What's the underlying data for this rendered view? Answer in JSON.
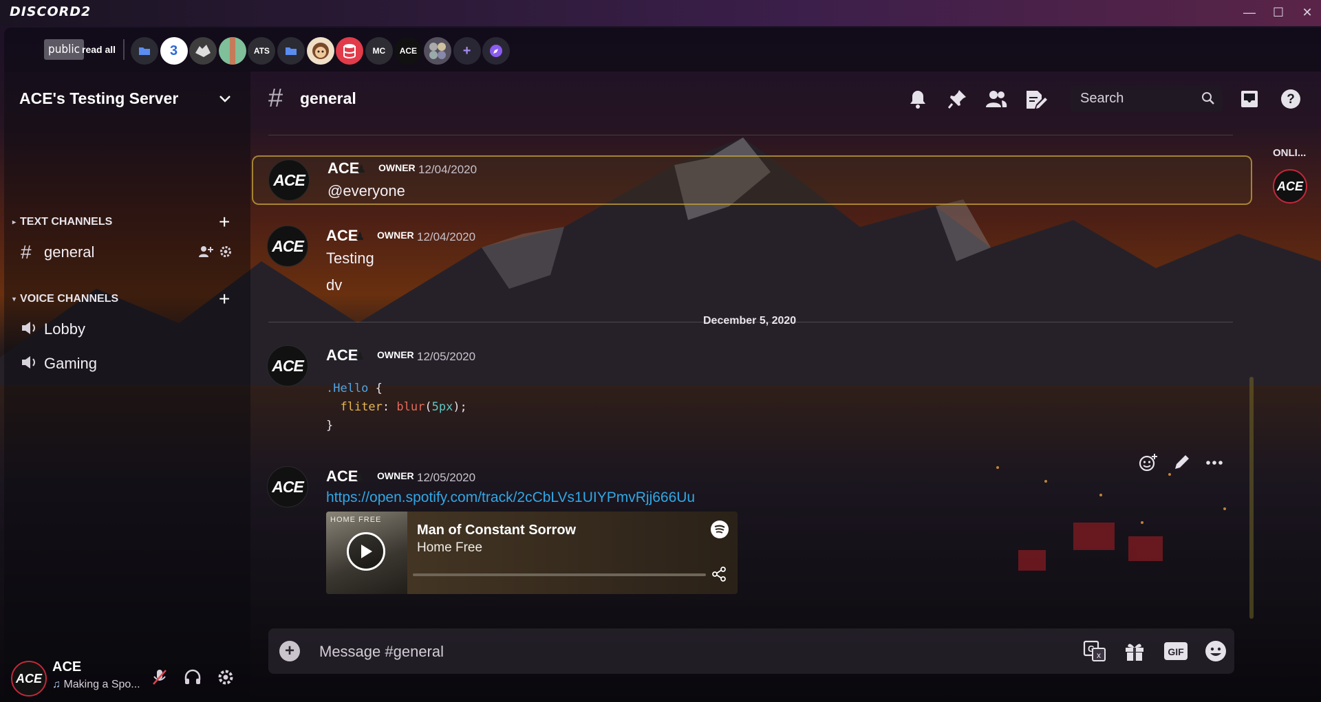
{
  "app": {
    "logo_text": "DISCORD2"
  },
  "window_controls": {
    "minimize": "—",
    "maximize": "☐",
    "close": "✕"
  },
  "server_bar": {
    "public_label": "public",
    "read_all_label": "read all",
    "servers": [
      {
        "name": "folder-1",
        "label": "",
        "color": "#2b2b34",
        "glyph": "folder"
      },
      {
        "name": "server-3",
        "label": "3",
        "color": "#ffffff",
        "glyph": "text"
      },
      {
        "name": "server-wolf",
        "label": "",
        "color": "#3d3d3d",
        "glyph": "wolf"
      },
      {
        "name": "server-green",
        "label": "",
        "color": "#7fbf9a",
        "glyph": "stripe"
      },
      {
        "name": "server-ats",
        "label": "ATS",
        "color": "#2d2d33",
        "glyph": "text"
      },
      {
        "name": "folder-2",
        "label": "",
        "color": "#2b2b34",
        "glyph": "folder"
      },
      {
        "name": "server-face",
        "label": "",
        "color": "#f0e0c8",
        "glyph": "face"
      },
      {
        "name": "server-db",
        "label": "",
        "color": "#e23b4a",
        "glyph": "db"
      },
      {
        "name": "server-mc",
        "label": "MC",
        "color": "#2d2d33",
        "glyph": "text"
      },
      {
        "name": "server-ace",
        "label": "ACE",
        "color": "#111111",
        "glyph": "text"
      },
      {
        "name": "server-multi",
        "label": "",
        "color": "#55505e",
        "glyph": "multi"
      },
      {
        "name": "add-server",
        "label": "+",
        "color": "#2a2734",
        "glyph": "text"
      },
      {
        "name": "explore-servers",
        "label": "",
        "color": "#2a2734",
        "glyph": "compass"
      }
    ]
  },
  "sidebar": {
    "server_name": "ACE's Testing Server",
    "categories": [
      {
        "label": "TEXT CHANNELS"
      },
      {
        "label": "VOICE CHANNELS"
      }
    ],
    "text_channels": [
      {
        "label": "general"
      }
    ],
    "voice_channels": [
      {
        "label": "Lobby"
      },
      {
        "label": "Gaming"
      }
    ]
  },
  "user_panel": {
    "avatar_text": "ACE",
    "name": "ACE",
    "status": "Making a Spo..."
  },
  "chat_header": {
    "channel_name": "general",
    "search_placeholder": "Search"
  },
  "messages": [
    {
      "avatar": "ACE",
      "author": "ACE",
      "role": "OWNER",
      "date": "12/04/2020",
      "lines": [
        "@everyone"
      ],
      "highlight": true
    },
    {
      "avatar": "ACE",
      "author": "ACE",
      "role": "OWNER",
      "date": "12/04/2020",
      "lines": [
        "Testing",
        "dv"
      ]
    },
    {
      "avatar": "ACE",
      "author": "ACE",
      "role": "OWNER",
      "date": "12/05/2020",
      "lines": []
    },
    {
      "avatar": "ACE",
      "author": "ACE",
      "role": "OWNER",
      "date": "12/05/2020",
      "lines": []
    }
  ],
  "date_separator": "December 5, 2020",
  "code_block": {
    "line1_selector": ".Hello",
    "line1_brace": " {",
    "line2_prop": "fliter",
    "line2_colon": ": ",
    "line2_fn": "blur",
    "line2_open": "(",
    "line2_num": "5px",
    "line2_close": ");",
    "line3": "}"
  },
  "spotify": {
    "link": "https://open.spotify.com/track/2cCbLVs1UIYPmvRjj666Uu",
    "album_label": "HOME FREE",
    "track_title": "Man of Constant Sorrow",
    "artist": "Home Free",
    "progress": 0.0
  },
  "composer": {
    "placeholder": "Message #general"
  },
  "members": {
    "online_label": "ONLI...",
    "avatar_text": "ACE"
  },
  "colors": {
    "accent_link": "#30a8e6",
    "highlight_border": "#c8a53c",
    "status_red": "#c3283a"
  }
}
